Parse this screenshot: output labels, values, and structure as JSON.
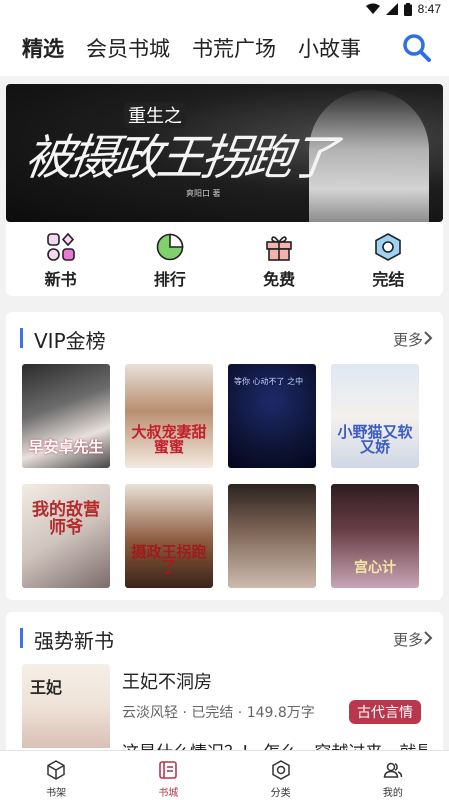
{
  "status": {
    "time": "8:47"
  },
  "topnav": {
    "tabs": [
      "精选",
      "会员书城",
      "书荒广场",
      "小故事"
    ]
  },
  "banner": {
    "subtitle": "重生之",
    "title": "被摄政王拐跑了",
    "author": "爽阳口 著"
  },
  "categories": [
    {
      "label": "新书",
      "icon": "grid-shapes-icon"
    },
    {
      "label": "排行",
      "icon": "pie-chart-icon"
    },
    {
      "label": "免费",
      "icon": "gift-icon"
    },
    {
      "label": "完结",
      "icon": "hexagon-icon"
    }
  ],
  "vip": {
    "title": "VIP金榜",
    "more": "更多",
    "covers": [
      "早安卓先生",
      "大叔宠妻甜蜜蜜",
      "等你 心动不了 之中",
      "小野猫又软又娇",
      "我的敌营师爷",
      "摄政王拐跑了",
      "",
      "宫心计"
    ]
  },
  "newbooks": {
    "title": "强势新书",
    "more": "更多",
    "book": {
      "cover": "王妃",
      "title": "王妃不洞房",
      "meta": "云淡风轻 · 已完结 · 149.8万字",
      "tag": "古代言情",
      "desc": "这是什么情况？！ 怎么一穿越过来，就是"
    }
  },
  "tabbar": [
    {
      "label": "书架",
      "icon": "cube-icon"
    },
    {
      "label": "书城",
      "icon": "book-list-icon"
    },
    {
      "label": "分类",
      "icon": "hexagon-nut-icon"
    },
    {
      "label": "我的",
      "icon": "people-icon"
    }
  ],
  "colors": {
    "accent": "#3b74e8",
    "brand": "#b8374c"
  }
}
